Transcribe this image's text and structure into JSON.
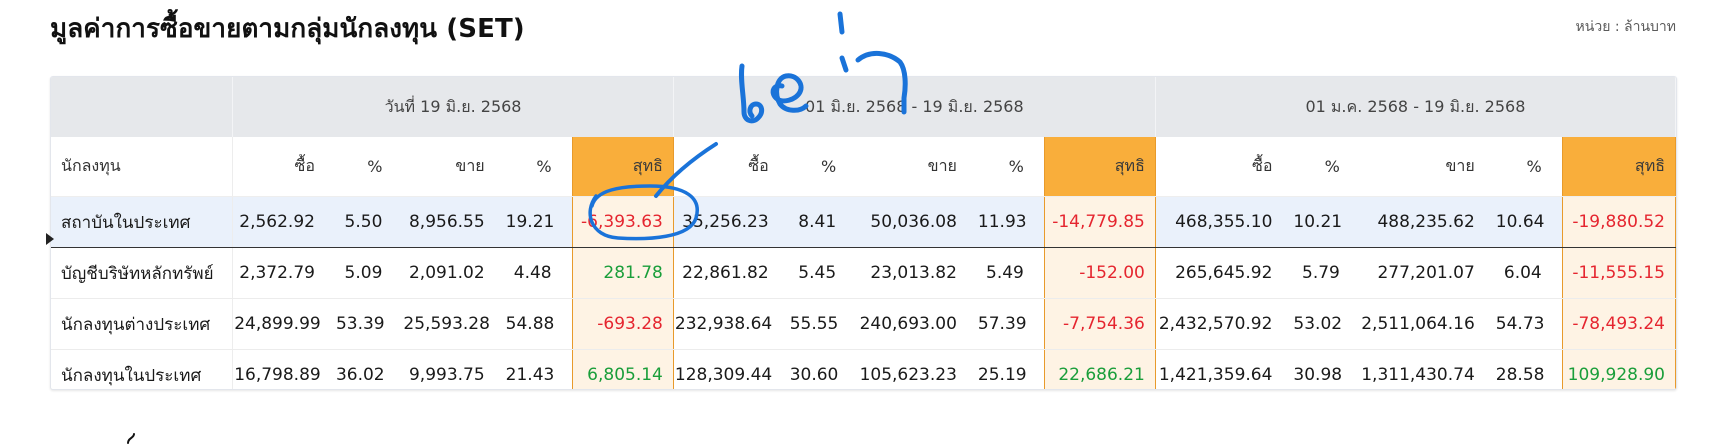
{
  "title": "มูลค่าการซื้อขายตามกลุ่มนักลงทุน (SET)",
  "unit": "หน่วย : ล้านบาท",
  "periods": [
    "วันที่ 19 มิ.ย. 2568",
    "01 มิ.ย. 2568 - 19 มิ.ย. 2568",
    "01 ม.ค. 2568 - 19 มิ.ย. 2568"
  ],
  "columns": {
    "investor": "นักลงทุน",
    "buy": "ซื้อ",
    "pct": "%",
    "sell": "ขาย",
    "net": "สุทธิ"
  },
  "rows": [
    {
      "investor": "สถาบันในประเทศ",
      "day": [
        "2,562.92",
        "5.50",
        "8,956.55",
        "19.21",
        "-6,393.63"
      ],
      "month": [
        "35,256.23",
        "8.41",
        "50,036.08",
        "11.93",
        "-14,779.85"
      ],
      "ytd": [
        "468,355.10",
        "10.21",
        "488,235.62",
        "10.64",
        "-19,880.52"
      ]
    },
    {
      "investor": "บัญชีบริษัทหลักทรัพย์",
      "day": [
        "2,372.79",
        "5.09",
        "2,091.02",
        "4.48",
        "281.78"
      ],
      "month": [
        "22,861.82",
        "5.45",
        "23,013.82",
        "5.49",
        "-152.00"
      ],
      "ytd": [
        "265,645.92",
        "5.79",
        "277,201.07",
        "6.04",
        "-11,555.15"
      ]
    },
    {
      "investor": "นักลงทุนต่างประเทศ",
      "day": [
        "24,899.99",
        "53.39",
        "25,593.28",
        "54.88",
        "-693.28"
      ],
      "month": [
        "232,938.64",
        "55.55",
        "240,693.00",
        "57.39",
        "-7,754.36"
      ],
      "ytd": [
        "2,432,570.92",
        "53.02",
        "2,511,064.16",
        "54.73",
        "-78,493.24"
      ]
    },
    {
      "investor": "นักลงทุนในประเทศ",
      "day": [
        "16,798.89",
        "36.02",
        "9,993.75",
        "21.43",
        "6,805.14"
      ],
      "month": [
        "128,309.44",
        "30.60",
        "105,623.23",
        "25.19",
        "22,686.21"
      ],
      "ytd": [
        "1,421,359.64",
        "30.98",
        "1,311,430.74",
        "28.58",
        "109,928.90"
      ]
    }
  ],
  "annotation": {
    "text": "เฆ่า",
    "color": "#1a73d9"
  },
  "colors": {
    "net_header": "#f9ae3b",
    "net_cell": "#fef3e4",
    "negative": "#e5252f",
    "positive": "#1a9e3a",
    "group_header": "#e6e8eb",
    "selected_row": "#eaf1fb"
  }
}
